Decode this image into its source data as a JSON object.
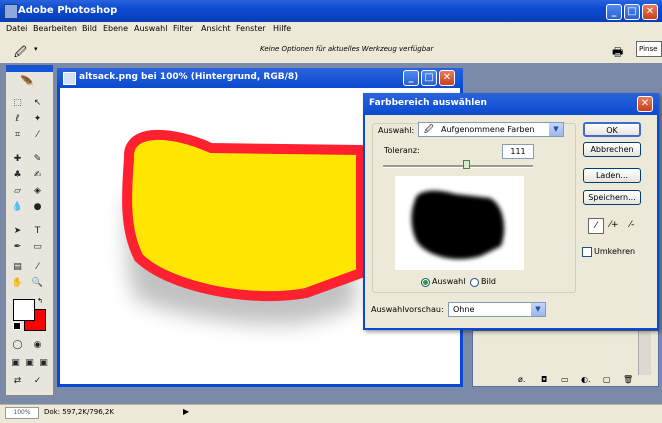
{
  "app": {
    "title": "Adobe Photoshop"
  },
  "window_controls": {
    "minimize": "_",
    "maximize": "□",
    "close": "✕"
  },
  "menu": [
    "Datei",
    "Bearbeiten",
    "Bild",
    "Ebene",
    "Auswahl",
    "Filter",
    "Ansicht",
    "Fenster",
    "Hilfe"
  ],
  "options_bar": {
    "message": "Keine Optionen für aktuelles Werkzeug verfügbar",
    "palette_label": "Pinse"
  },
  "document": {
    "title": "altsack.png bei 100% (Hintergrund, RGB/8)"
  },
  "dialog": {
    "title": "Farbbereich auswählen",
    "auswahl_label": "Auswahl:",
    "auswahl_value": "Aufgenommene Farben",
    "toleranz_label": "Toleranz:",
    "toleranz_value": "111",
    "toleranz_level": 0.55,
    "radio_auswahl": "Auswahl",
    "radio_bild": "Bild",
    "preview_label": "Auswahlvorschau:",
    "preview_value": "Ohne",
    "buttons": {
      "ok": "OK",
      "cancel": "Abbrechen",
      "load": "Laden...",
      "save": "Speichern..."
    },
    "invert_label": "Umkehren"
  },
  "status": {
    "zoom": "100%",
    "doc": "Dok: 597,2K/796,2K"
  },
  "colors": {
    "foreground": "#ffffff",
    "background": "#ff0000",
    "accent": "#0a49d0",
    "shape_fill": "#ffe600",
    "shape_stroke": "#ff2030"
  }
}
